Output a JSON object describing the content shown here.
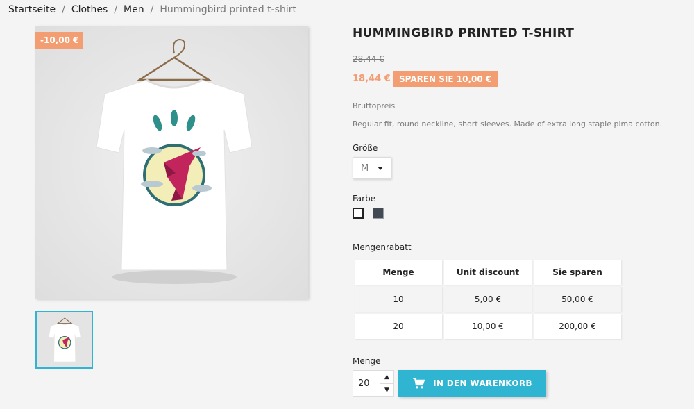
{
  "breadcrumb": {
    "items": [
      "Startseite",
      "Clothes",
      "Men"
    ],
    "current": "Hummingbird printed t-shirt"
  },
  "product": {
    "title": "HUMMINGBIRD PRINTED T-SHIRT",
    "discount_flag": "-10,00 €",
    "regular_price": "28,44 €",
    "price": "18,44 €",
    "save_badge": "SPAREN SIE 10,00 €",
    "tax_label": "Bruttopreis",
    "short_description": "Regular fit, round neckline, short sleeves. Made of extra long staple pima cotton."
  },
  "variants": {
    "size_label": "Größe",
    "size_value": "M",
    "color_label": "Farbe",
    "colors": [
      "#ffffff",
      "#434a54"
    ]
  },
  "volume_discounts": {
    "label": "Mengenrabatt",
    "headers": [
      "Menge",
      "Unit discount",
      "Sie sparen"
    ],
    "rows": [
      [
        "10",
        "5,00 €",
        "50,00 €"
      ],
      [
        "20",
        "10,00 €",
        "200,00 €"
      ]
    ]
  },
  "quantity": {
    "label": "Menge",
    "value": "20"
  },
  "add_to_cart": {
    "label": "IN DEN WARENKORB",
    "icon": "cart-icon"
  },
  "colors": {
    "accent": "#2fb5d2",
    "discount": "#f39d72"
  }
}
